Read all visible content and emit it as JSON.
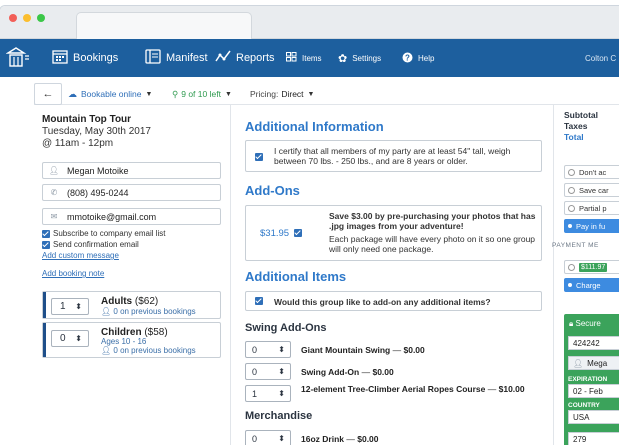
{
  "nav": {
    "bookings": "Bookings",
    "manifest": "Manifest",
    "reports": "Reports",
    "items": "Items",
    "settings": "Settings",
    "help": "Help",
    "user": "Colton C"
  },
  "toolbar": {
    "back_icon": "arrow-left",
    "status": "Bookable online",
    "capacity": "9 of 10 left",
    "pricing_label": "Pricing:",
    "pricing_value": "Direct"
  },
  "booking": {
    "tour": "Mountain Top Tour",
    "date": "Tuesday, May 30th 2017",
    "time": "@ 11am - 12pm",
    "name": "Megan Motoike",
    "phone": "(808) 495-0244",
    "email": "mmotoike@gmail.com",
    "subscribe": "Subscribe to company email list",
    "send_confirmation": "Send confirmation email",
    "add_custom_message": "Add custom message",
    "add_booking_note": "Add booking note"
  },
  "guests": [
    {
      "qty": "1",
      "type": "Adults",
      "price": "($62)",
      "sub": "0 on previous bookings",
      "ages": ""
    },
    {
      "qty": "0",
      "type": "Children",
      "price": "($58)",
      "sub": "0 on previous bookings",
      "ages": "Ages 10 - 16"
    }
  ],
  "main": {
    "additional_info_title": "Additional Information",
    "additional_info_text": "I certify that all members of my party are at least 54\" tall, weigh between 70 lbs. - 250 lbs., and are 8 years or older.",
    "addons_title": "Add-Ons",
    "addon_price": "$31.95",
    "addon_headline": "Save $3.00 by pre-purchasing your photos that has .jpg images from your adventure!",
    "addon_desc": "Each package will have every photo on it so one group will only need one package.",
    "additional_items_title": "Additional Items",
    "additional_items_question": "Would this group like to add-on any additional items?",
    "swing_title": "Swing Add-Ons",
    "merch_title": "Merchandise",
    "items": [
      {
        "qty": "0",
        "name": "Giant Mountain Swing",
        "price": "$0.00"
      },
      {
        "qty": "0",
        "name": "Swing Add-On",
        "price": "$0.00"
      },
      {
        "qty": "1",
        "name": "12-element Tree-Climber Aerial Ropes Course",
        "price": "$10.00"
      },
      {
        "qty": "0",
        "name": "16oz Drink",
        "price": "$0.00"
      }
    ]
  },
  "summary": {
    "subtotal": "Subtotal",
    "taxes": "Taxes",
    "total": "Total",
    "opt1": "Don't ac",
    "opt2": "Save car",
    "opt3": "Partial p",
    "opt4": "Pay in fu",
    "payment_method": "PAYMENT ME",
    "amount": "$111.97",
    "charge": "Charge",
    "secure": "Secure",
    "card_number": "424242",
    "card_name": "Mega",
    "expiration_label": "EXPIRATION",
    "expiration_value": "02 - Feb",
    "country_label": "COUNTRY",
    "country_value": "USA",
    "cvc": "279"
  },
  "colors": {
    "nav": "#1d5f9e",
    "accent": "#2f79c9",
    "secure": "#3ba35b"
  }
}
